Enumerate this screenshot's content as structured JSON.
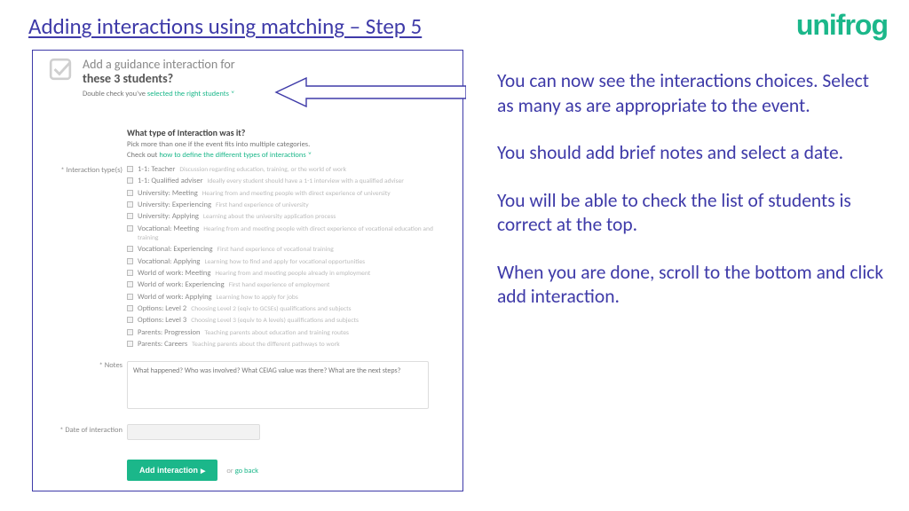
{
  "slide": {
    "title": "Adding interactions using matching – Step 5"
  },
  "brand": {
    "name": "unifrog"
  },
  "screenshot": {
    "heading_small": "Add a guidance interaction for",
    "heading_bold": "these 3 students?",
    "sub_prefix": "Double check you've ",
    "sub_link": "selected the right students",
    "section": {
      "question": "What type of Interaction was it?",
      "help1": "Pick more than one if the event fits into multiple categories.",
      "help2_prefix": "Check out ",
      "help2_link": "how to define the different types of interactions"
    },
    "labels": {
      "types": "* Interaction type(s)",
      "notes": "* Notes",
      "date": "* Date of interaction"
    },
    "types": [
      {
        "name": "1-1: Teacher",
        "desc": "Discussion regarding education, training, or the world of work"
      },
      {
        "name": "1-1: Qualified adviser",
        "desc": "Ideally every student should have a 1-1 interview with a qualified adviser"
      },
      {
        "name": "University: Meeting",
        "desc": "Hearing from and meeting people with direct experience of university"
      },
      {
        "name": "University: Experiencing",
        "desc": "First hand experience of university"
      },
      {
        "name": "University: Applying",
        "desc": "Learning about the university application process"
      },
      {
        "name": "Vocational: Meeting",
        "desc": "Hearing from and meeting people with direct experience of vocational education and training"
      },
      {
        "name": "Vocational: Experiencing",
        "desc": "First hand experience of vocational training"
      },
      {
        "name": "Vocational: Applying",
        "desc": "Learning how to find and apply for vocational opportunities"
      },
      {
        "name": "World of work: Meeting",
        "desc": "Hearing from and meeting people already in employment"
      },
      {
        "name": "World of work: Experiencing",
        "desc": "First hand experience of employment"
      },
      {
        "name": "World of work: Applying",
        "desc": "Learning how to apply for jobs"
      },
      {
        "name": "Options: Level 2",
        "desc": "Choosing Level 2 (eqiv to GCSEs) qualifications and subjects"
      },
      {
        "name": "Options: Level 3",
        "desc": "Choosing Level 3 (equiv to A levels) qualifications and subjects"
      },
      {
        "name": "Parents: Progression",
        "desc": "Teaching parents about education and training routes"
      },
      {
        "name": "Parents: Careers",
        "desc": "Teaching parents about the different pathways to work"
      }
    ],
    "notes_placeholder": "What happened? Who was involved? What CEIAG value was there? What are the next steps?",
    "button": "Add interaction",
    "or_text": "or ",
    "go_back": "go back"
  },
  "explain": {
    "p1": "You can now see the interactions choices. Select as many as are appropriate to the event.",
    "p2": "You should add brief notes and select a date.",
    "p3": "You will be able to check the list of students is correct at the top.",
    "p4": "When you are done, scroll to the bottom and click add interaction."
  }
}
